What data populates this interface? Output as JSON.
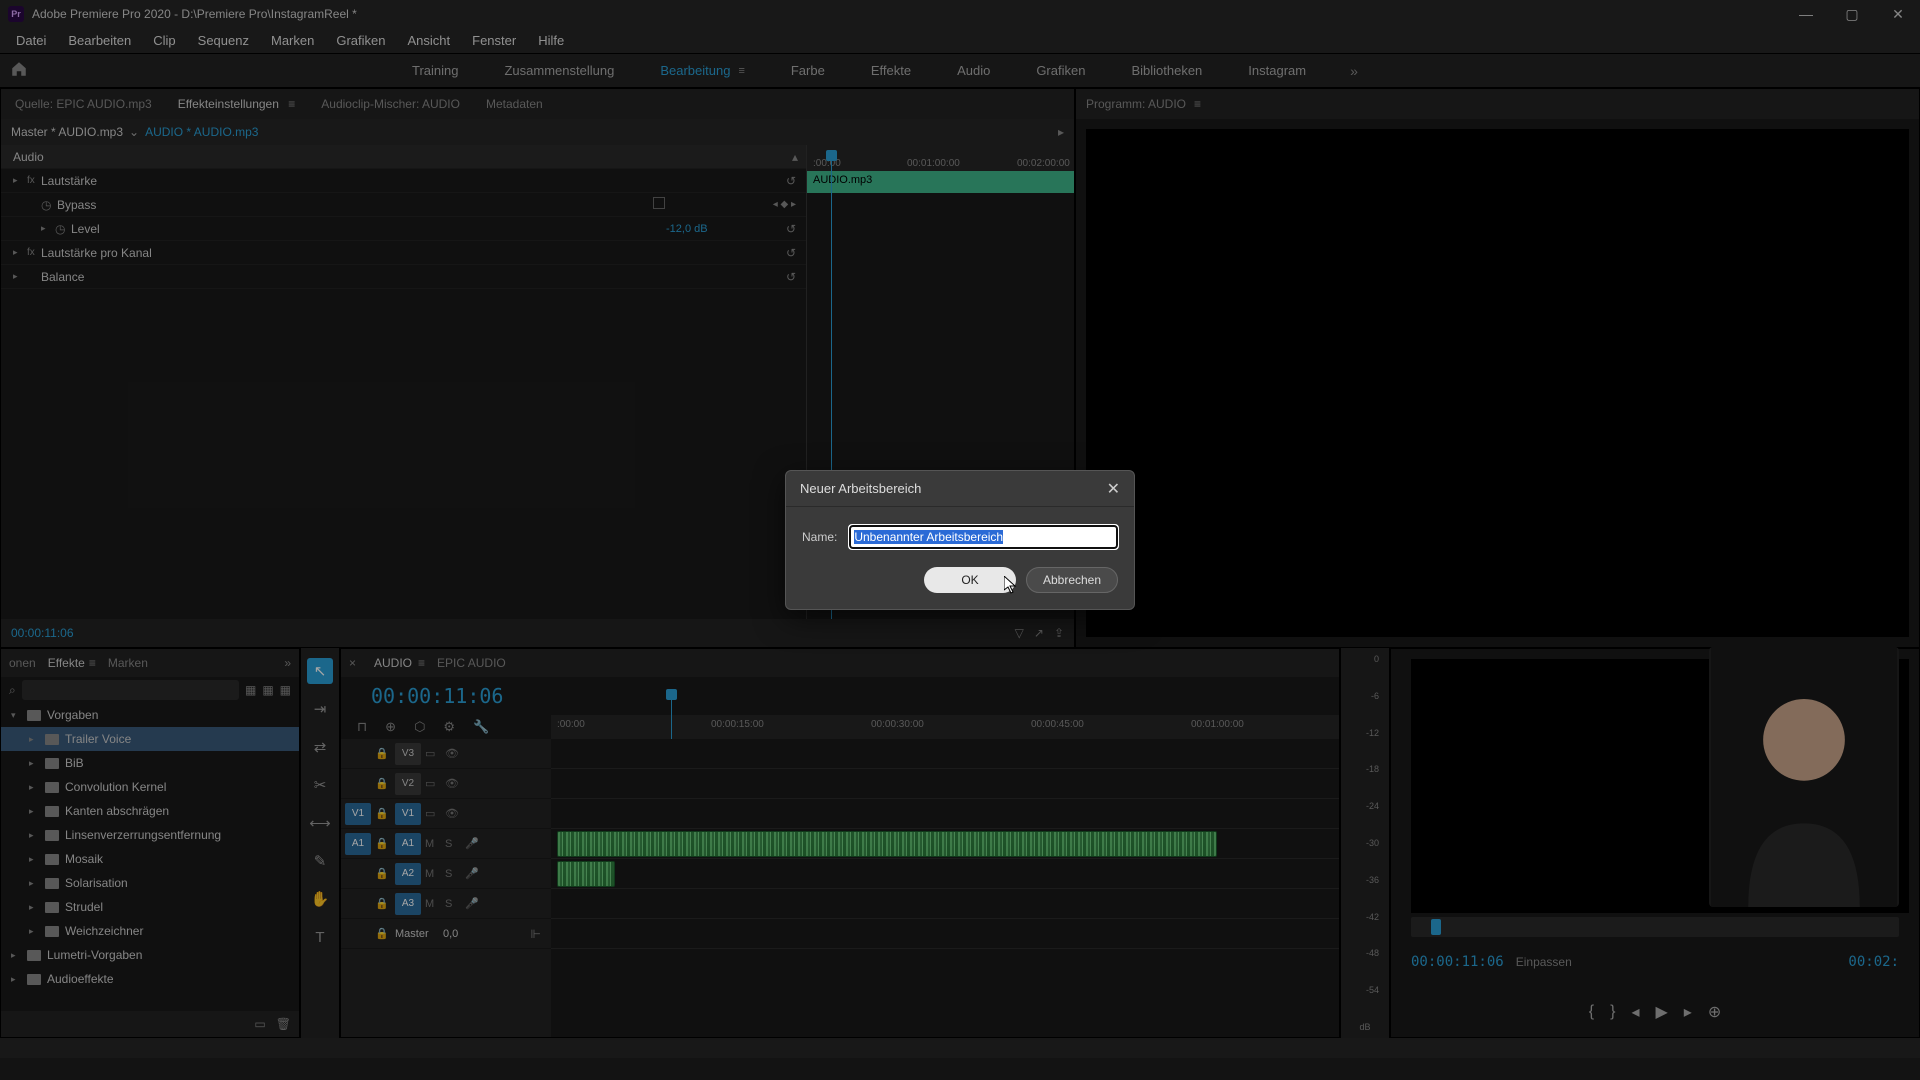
{
  "titlebar": {
    "app_icon_text": "Pr",
    "title": "Adobe Premiere Pro 2020 - D:\\Premiere Pro\\InstagramReel *"
  },
  "menubar": [
    "Datei",
    "Bearbeiten",
    "Clip",
    "Sequenz",
    "Marken",
    "Grafiken",
    "Ansicht",
    "Fenster",
    "Hilfe"
  ],
  "workspaces": {
    "items": [
      "Training",
      "Zusammenstellung",
      "Bearbeitung",
      "Farbe",
      "Effekte",
      "Audio",
      "Grafiken",
      "Bibliotheken",
      "Instagram"
    ],
    "active_index": 2,
    "overflow": "»"
  },
  "effect_controls": {
    "tabs": [
      "Quelle: EPIC AUDIO.mp3",
      "Effekteinstellungen",
      "Audioclip-Mischer: AUDIO",
      "Metadaten"
    ],
    "active_tab_index": 1,
    "master_label": "Master * AUDIO.mp3",
    "clip_label": "AUDIO * AUDIO.mp3",
    "section_audio": "Audio",
    "rows": {
      "lautstarke": "Lautstärke",
      "bypass": "Bypass",
      "level": "Level",
      "level_val": "-12,0 dB",
      "laut_kanal": "Lautstärke pro Kanal",
      "balance": "Balance"
    },
    "ruler": {
      "t0": ":00:00",
      "t1": "00:01:00:00",
      "t2": "00:02:00:00"
    },
    "clip_name": "AUDIO.mp3",
    "footer_tc": "00:00:11:06"
  },
  "program": {
    "tab_label": "Programm: AUDIO"
  },
  "project": {
    "tabs": [
      "onen",
      "Effekte",
      "Marken"
    ],
    "active_tab_index": 1,
    "tree": [
      {
        "label": "Vorgaben",
        "depth": 0,
        "expanded": true
      },
      {
        "label": "Trailer Voice",
        "depth": 1,
        "selected": true
      },
      {
        "label": "BiB",
        "depth": 1
      },
      {
        "label": "Convolution Kernel",
        "depth": 1
      },
      {
        "label": "Kanten abschrägen",
        "depth": 1
      },
      {
        "label": "Linsenverzerrungsentfernung",
        "depth": 1
      },
      {
        "label": "Mosaik",
        "depth": 1
      },
      {
        "label": "Solarisation",
        "depth": 1
      },
      {
        "label": "Strudel",
        "depth": 1
      },
      {
        "label": "Weichzeichner",
        "depth": 1
      },
      {
        "label": "Lumetri-Vorgaben",
        "depth": 0
      },
      {
        "label": "Audioeffekte",
        "depth": 0
      }
    ]
  },
  "timeline": {
    "tabs": [
      "AUDIO",
      "EPIC AUDIO"
    ],
    "active_tab_index": 0,
    "timecode": "00:00:11:06",
    "ruler": [
      ":00:00",
      "00:00:15:00",
      "00:00:30:00",
      "00:00:45:00",
      "00:01:00:00"
    ],
    "tracks": {
      "v3": "V3",
      "v2": "V2",
      "v1": "V1",
      "a1": "A1",
      "a2": "A2",
      "a3": "A3",
      "master": "Master",
      "master_val": "0,0",
      "m": "M",
      "s": "S"
    }
  },
  "meters": {
    "scale": [
      "0",
      "-6",
      "-12",
      "-18",
      "-24",
      "-30",
      "-36",
      "-42",
      "-48",
      "-54",
      ""
    ],
    "unit": "dB"
  },
  "program_lower": {
    "timecode_left": "00:00:11:06",
    "fit_label": "Einpassen",
    "timecode_right": "00:02:"
  },
  "dialog": {
    "title": "Neuer Arbeitsbereich",
    "name_label": "Name:",
    "name_value": "Unbenannter Arbeitsbereich",
    "ok": "OK",
    "cancel": "Abbrechen"
  }
}
